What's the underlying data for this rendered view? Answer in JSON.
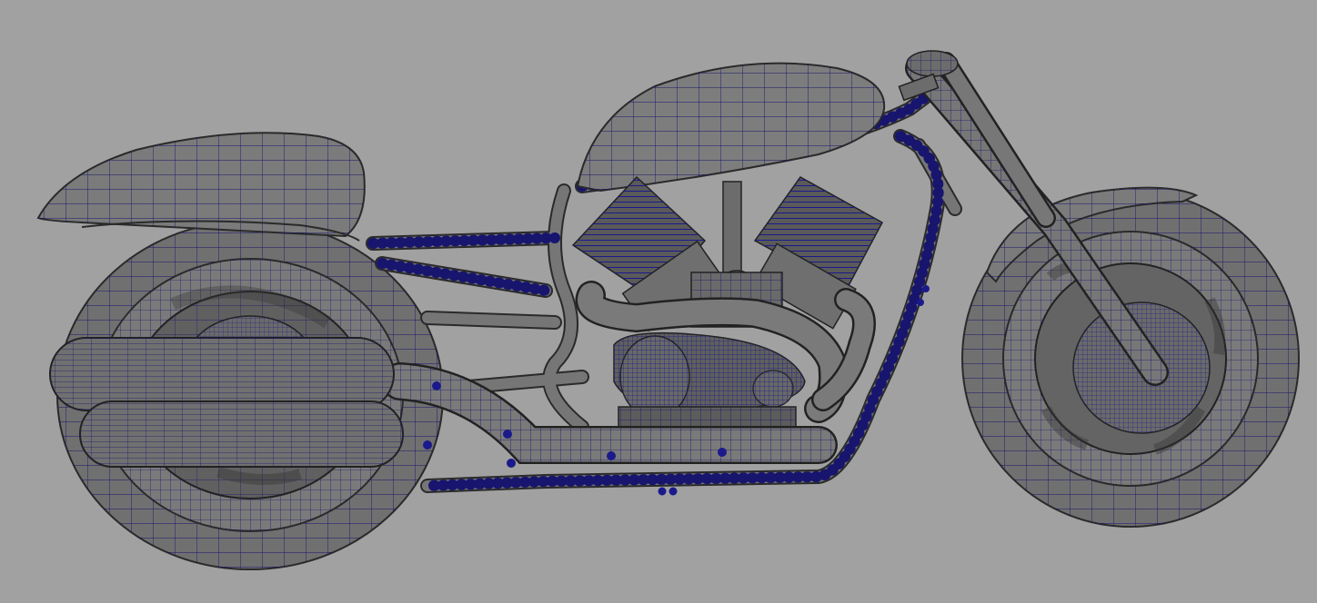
{
  "viewport": {
    "background": "#a1a1a1",
    "model_name": "motorcycle",
    "display_mode": "wireframe-on-shaded",
    "colors": {
      "surface": "#6f6f6f",
      "surface_light": "#8c8c8c",
      "surface_dark": "#4f4f4f",
      "outline": "#2a2a2a",
      "wireframe": "#17156e",
      "wireframe_dense": "#1b1a8c"
    }
  }
}
